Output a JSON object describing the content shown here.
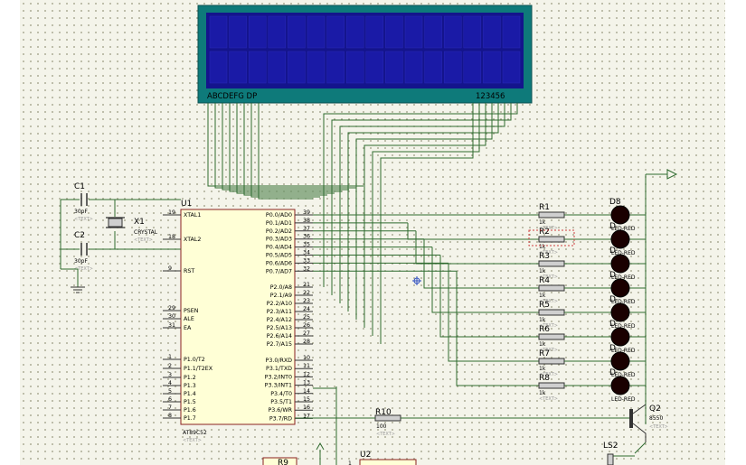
{
  "lcd": {
    "left_label": "ABCDEFG  DP",
    "right_label": "123456",
    "colors": {
      "bezel": "#0e7a7a",
      "screen": "#14148c"
    }
  },
  "mcu": {
    "ref": "U1",
    "part": "AT89C52",
    "text_hint": "<TEXT>",
    "left_pins": [
      {
        "num": "19",
        "name": "XTAL1"
      },
      {
        "num": "18",
        "name": "XTAL2"
      },
      {
        "num": "9",
        "name": "RST"
      },
      {
        "num": "29",
        "name": "PSEN"
      },
      {
        "num": "30",
        "name": "ALE"
      },
      {
        "num": "31",
        "name": "EA"
      },
      {
        "num": "1",
        "name": "P1.0/T2"
      },
      {
        "num": "2",
        "name": "P1.1/T2EX"
      },
      {
        "num": "3",
        "name": "P1.2"
      },
      {
        "num": "4",
        "name": "P1.3"
      },
      {
        "num": "5",
        "name": "P1.4"
      },
      {
        "num": "6",
        "name": "P1.5"
      },
      {
        "num": "7",
        "name": "P1.6"
      },
      {
        "num": "8",
        "name": "P1.7"
      }
    ],
    "right_pins": [
      {
        "num": "39",
        "name": "P0.0/AD0"
      },
      {
        "num": "38",
        "name": "P0.1/AD1"
      },
      {
        "num": "37",
        "name": "P0.2/AD2"
      },
      {
        "num": "36",
        "name": "P0.3/AD3"
      },
      {
        "num": "35",
        "name": "P0.4/AD4"
      },
      {
        "num": "34",
        "name": "P0.5/AD5"
      },
      {
        "num": "33",
        "name": "P0.6/AD6"
      },
      {
        "num": "32",
        "name": "P0.7/AD7"
      },
      {
        "num": "21",
        "name": "P2.0/A8"
      },
      {
        "num": "22",
        "name": "P2.1/A9"
      },
      {
        "num": "23",
        "name": "P2.2/A10"
      },
      {
        "num": "24",
        "name": "P2.3/A11"
      },
      {
        "num": "25",
        "name": "P2.4/A12"
      },
      {
        "num": "26",
        "name": "P2.5/A13"
      },
      {
        "num": "27",
        "name": "P2.6/A14"
      },
      {
        "num": "28",
        "name": "P2.7/A15"
      },
      {
        "num": "10",
        "name": "P3.0/RXD"
      },
      {
        "num": "11",
        "name": "P3.1/TXD"
      },
      {
        "num": "12",
        "name": "P3.2/INT0"
      },
      {
        "num": "13",
        "name": "P3.3/INT1"
      },
      {
        "num": "14",
        "name": "P3.4/T0"
      },
      {
        "num": "15",
        "name": "P3.5/T1"
      },
      {
        "num": "16",
        "name": "P3.6/WR"
      },
      {
        "num": "17",
        "name": "P3.7/RD"
      }
    ]
  },
  "caps": [
    {
      "ref": "C1",
      "value": "30pF",
      "hint": "<TEXT>"
    },
    {
      "ref": "C2",
      "value": "30pF",
      "hint": "<TEXT>"
    }
  ],
  "crystal": {
    "ref": "X1",
    "value": "CRYSTAL",
    "hint": "<TEXT>"
  },
  "resistors": [
    {
      "ref": "R1",
      "value": "1k",
      "hint": "<TEXT>"
    },
    {
      "ref": "R2",
      "value": "1k",
      "hint": "<TEXT>"
    },
    {
      "ref": "R3",
      "value": "1k",
      "hint": "<TEXT>"
    },
    {
      "ref": "R4",
      "value": "1k",
      "hint": "<TEXT>"
    },
    {
      "ref": "R5",
      "value": "1k",
      "hint": "<TEXT>"
    },
    {
      "ref": "R6",
      "value": "1k",
      "hint": "<TEXT>"
    },
    {
      "ref": "R7",
      "value": "1k",
      "hint": "<TEXT>"
    },
    {
      "ref": "R8",
      "value": "1k",
      "hint": "<TEXT>"
    }
  ],
  "leds": [
    {
      "ref": "D8",
      "value": "LED-RED"
    },
    {
      "ref": "D",
      "value": "LED-RED"
    },
    {
      "ref": "D",
      "value": "LED-RED"
    },
    {
      "ref": "D",
      "value": "LED-RED"
    },
    {
      "ref": "D",
      "value": "LED-RED"
    },
    {
      "ref": "D",
      "value": "LED-RED"
    },
    {
      "ref": "D",
      "value": "LED-RED"
    },
    {
      "ref": "D",
      "value": "LED-RED"
    }
  ],
  "r10": {
    "ref": "R10",
    "value": "100",
    "hint": "<TEXT>"
  },
  "q2": {
    "ref": "Q2",
    "value": "8550",
    "hint": "<TEXT>"
  },
  "ls2": {
    "ref": "LS2"
  },
  "u2": {
    "ref": "U2"
  },
  "r9_partial": {
    "ref": "R9"
  },
  "pin_one": "1"
}
